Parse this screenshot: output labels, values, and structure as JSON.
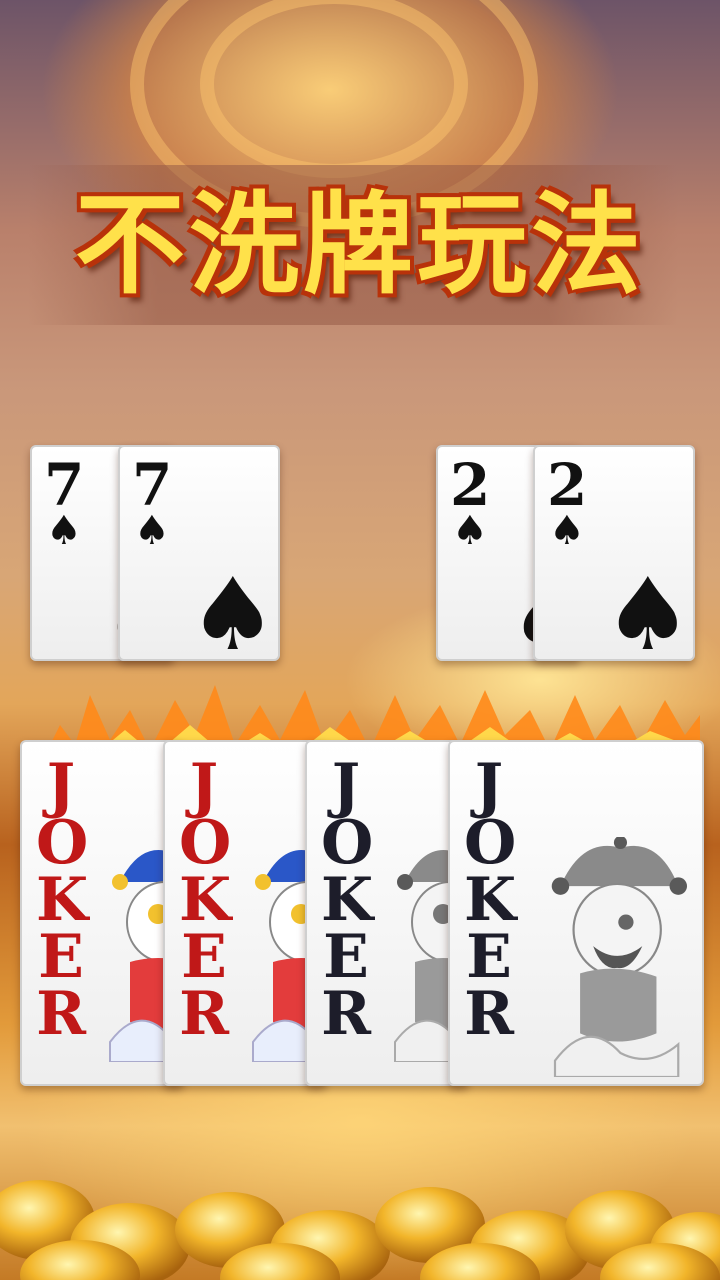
{
  "title": "不洗牌玩法",
  "top_row": [
    {
      "rank": "7",
      "suit": "spade-icon"
    },
    {
      "rank": "7",
      "suit": "spade-icon"
    },
    {
      "rank": "2",
      "suit": "spade-icon"
    },
    {
      "rank": "2",
      "suit": "spade-icon"
    }
  ],
  "jokers": [
    {
      "letters": [
        "J",
        "O",
        "K",
        "E",
        "R"
      ],
      "color": "#c01818",
      "kind": "red"
    },
    {
      "letters": [
        "J",
        "O",
        "K",
        "E",
        "R"
      ],
      "color": "#c01818",
      "kind": "red"
    },
    {
      "letters": [
        "J",
        "O",
        "K",
        "E",
        "R"
      ],
      "color": "#1d1d2a",
      "kind": "black"
    },
    {
      "letters": [
        "J",
        "O",
        "K",
        "E",
        "R"
      ],
      "color": "#1d1d2a",
      "kind": "black"
    }
  ]
}
